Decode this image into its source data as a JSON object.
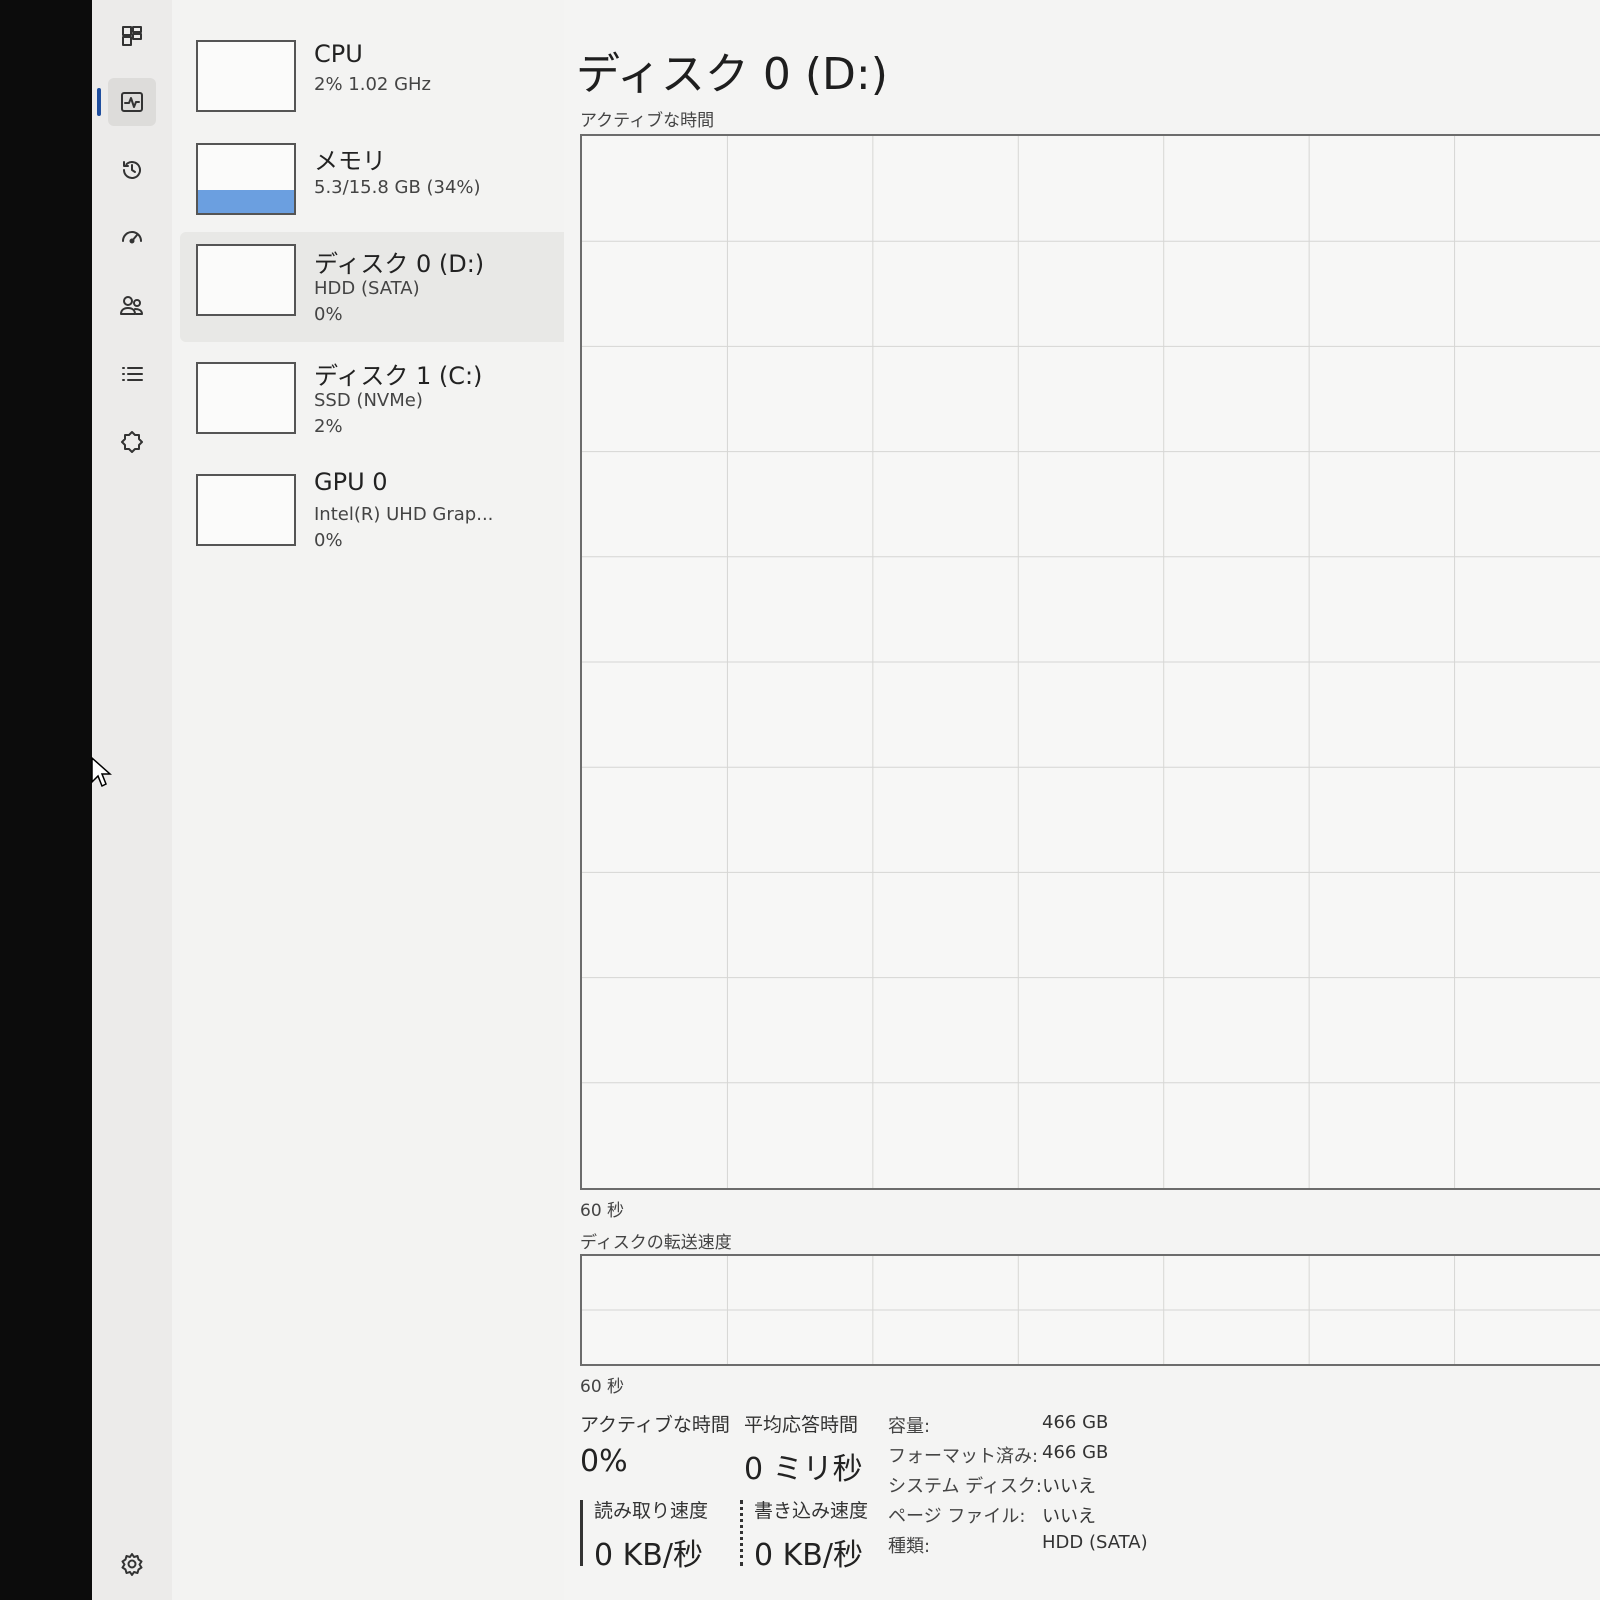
{
  "sidebar": {
    "items": [
      {
        "icon": "processes-icon"
      },
      {
        "icon": "performance-icon",
        "active": true
      },
      {
        "icon": "app-history-icon"
      },
      {
        "icon": "startup-apps-icon"
      },
      {
        "icon": "users-icon"
      },
      {
        "icon": "details-icon"
      },
      {
        "icon": "services-icon"
      }
    ],
    "footer_icon": "settings-icon"
  },
  "devices": [
    {
      "title": "CPU",
      "line1": "2%  1.02 GHz",
      "usage": 0.02
    },
    {
      "title": "メモリ",
      "line1": "5.3/15.8 GB (34%)",
      "usage": 0.34
    },
    {
      "title": "ディスク 0 (D:)",
      "line1": "HDD (SATA)",
      "line2": "0%",
      "usage": 0,
      "selected": true
    },
    {
      "title": "ディスク 1 (C:)",
      "line1": "SSD (NVMe)",
      "line2": "2%",
      "usage": 0.02
    },
    {
      "title": "GPU 0",
      "line1": "Intel(R) UHD Grap...",
      "line2": "0%",
      "usage": 0
    }
  ],
  "main": {
    "title": "ディスク 0 (D:)",
    "active_chart": {
      "label": "アクティブな時間",
      "x_label": "60 秒"
    },
    "transfer_chart": {
      "label": "ディスクの転送速度",
      "x_label": "60 秒"
    },
    "stats": {
      "active_time": {
        "label": "アクティブな時間",
        "value": "0%"
      },
      "avg_response": {
        "label": "平均応答時間",
        "value": "0 ミリ秒"
      },
      "read_speed": {
        "label": "読み取り速度",
        "value": "0 KB/秒"
      },
      "write_speed": {
        "label": "書き込み速度",
        "value": "0 KB/秒"
      }
    },
    "properties": [
      {
        "key": "容量:",
        "value": "466 GB"
      },
      {
        "key": "フォーマット済み:",
        "value": "466 GB"
      },
      {
        "key": "システム ディスク:",
        "value": "いいえ"
      },
      {
        "key": "ページ ファイル:",
        "value": "いいえ"
      },
      {
        "key": "種類:",
        "value": "HDD (SATA)"
      }
    ]
  },
  "colors": {
    "accent": "#1f4e9e",
    "memory_fill": "#6b9fe0",
    "chart_border": "#6c6c6c"
  }
}
